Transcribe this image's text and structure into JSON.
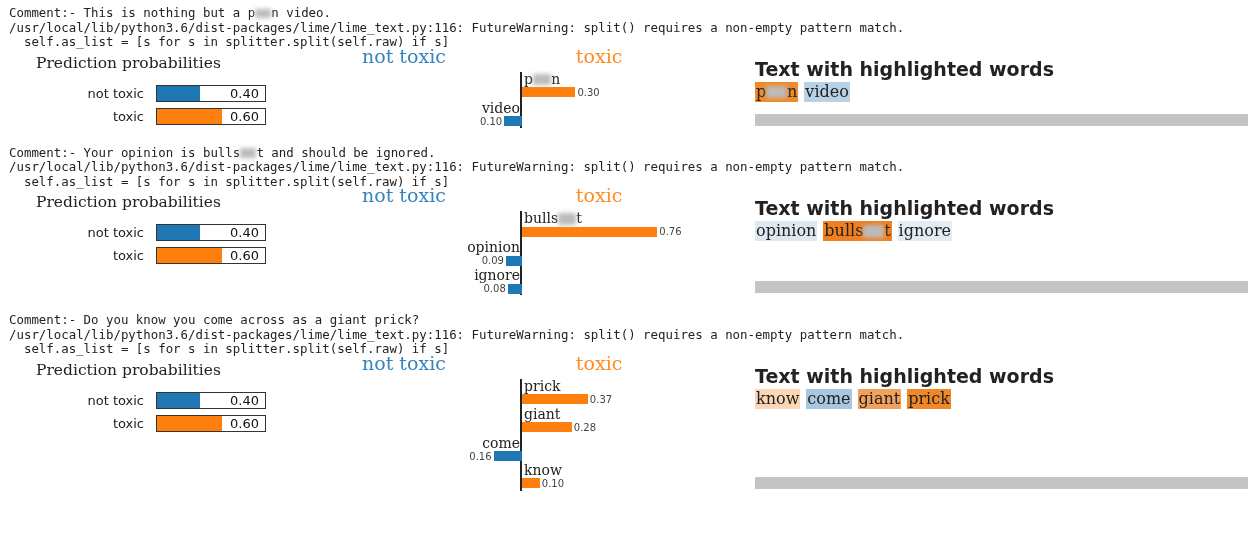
{
  "outputs": [
    {
      "comment": {
        "parts": [
          "Comment:- This is nothing but a p",
          "n video."
        ]
      },
      "warning": "/usr/local/lib/python3.6/dist-packages/lime/lime_text.py:116: FutureWarning: split() requires a non-empty pattern match.",
      "source_line": "  self.as_list = [s for s in splitter.split(self.raw) if s]",
      "probabilities": {
        "title": "Prediction probabilities",
        "classes": [
          {
            "label": "not toxic",
            "value": "0.40",
            "level": 0.4,
            "color": "#1f77b4"
          },
          {
            "label": "toxic",
            "value": "0.60",
            "level": 0.6,
            "color": "#ff7f0e"
          }
        ]
      },
      "explanation": {
        "left_title": "not toxic",
        "right_title": "toxic",
        "features": [
          {
            "parts": [
              "p",
              "n"
            ],
            "value": "0.30",
            "color": "#ff7f0e"
          },
          {
            "parts": [
              "video"
            ],
            "value": "0.10",
            "color": "#1f77b4"
          }
        ]
      },
      "highlighted": {
        "title": "Text with highlighted words",
        "words": [
          {
            "parts": [
              "p",
              "n"
            ],
            "color": "#f08a2c"
          },
          {
            "parts": [
              "video"
            ],
            "color": "#b8d1e4"
          }
        ]
      }
    },
    {
      "comment": {
        "parts": [
          "Comment:- Your opinion is bulls",
          "t and should be ignored."
        ]
      },
      "warning": "/usr/local/lib/python3.6/dist-packages/lime/lime_text.py:116: FutureWarning: split() requires a non-empty pattern match.",
      "source_line": "  self.as_list = [s for s in splitter.split(self.raw) if s]",
      "probabilities": {
        "title": "Prediction probabilities",
        "classes": [
          {
            "label": "not toxic",
            "value": "0.40",
            "level": 0.4,
            "color": "#1f77b4"
          },
          {
            "label": "toxic",
            "value": "0.60",
            "level": 0.6,
            "color": "#ff7f0e"
          }
        ]
      },
      "explanation": {
        "left_title": "not toxic",
        "right_title": "toxic",
        "features": [
          {
            "parts": [
              "bulls",
              "t"
            ],
            "value": "0.76",
            "color": "#ff7f0e"
          },
          {
            "parts": [
              "opinion"
            ],
            "value": "0.09",
            "color": "#1f77b4"
          },
          {
            "parts": [
              "ignore"
            ],
            "value": "0.08",
            "color": "#1f77b4"
          }
        ]
      },
      "highlighted": {
        "title": "Text with highlighted words",
        "words": [
          {
            "parts": [
              "opinion"
            ],
            "color": "#dde8f1"
          },
          {
            "parts": [
              "bulls",
              "t"
            ],
            "color": "#ef7f1f"
          },
          {
            "parts": [
              "ignore"
            ],
            "color": "#e3ecf4"
          }
        ]
      }
    },
    {
      "comment": {
        "parts": [
          "Comment:- Do you know you come across as a giant prick?"
        ]
      },
      "warning": "/usr/local/lib/python3.6/dist-packages/lime/lime_text.py:116: FutureWarning: split() requires a non-empty pattern match.",
      "source_line": "  self.as_list = [s for s in splitter.split(self.raw) if s]",
      "probabilities": {
        "title": "Prediction probabilities",
        "classes": [
          {
            "label": "not toxic",
            "value": "0.40",
            "level": 0.4,
            "color": "#1f77b4"
          },
          {
            "label": "toxic",
            "value": "0.60",
            "level": 0.6,
            "color": "#ff7f0e"
          }
        ]
      },
      "explanation": {
        "left_title": "not toxic",
        "right_title": "toxic",
        "features": [
          {
            "parts": [
              "prick"
            ],
            "value": "0.37",
            "color": "#ff7f0e"
          },
          {
            "parts": [
              "giant"
            ],
            "value": "0.28",
            "color": "#ff7f0e"
          },
          {
            "parts": [
              "come"
            ],
            "value": "0.16",
            "color": "#1f77b4"
          },
          {
            "parts": [
              "know"
            ],
            "value": "0.10",
            "color": "#ff7f0e"
          }
        ]
      },
      "highlighted": {
        "title": "Text with highlighted words",
        "words": [
          {
            "parts": [
              "know"
            ],
            "color": "#fbd7b5"
          },
          {
            "parts": [
              "come"
            ],
            "color": "#a9c8e0"
          },
          {
            "parts": [
              "giant"
            ],
            "color": "#f2a15a"
          },
          {
            "parts": [
              "prick"
            ],
            "color": "#f0882a"
          }
        ]
      }
    }
  ]
}
